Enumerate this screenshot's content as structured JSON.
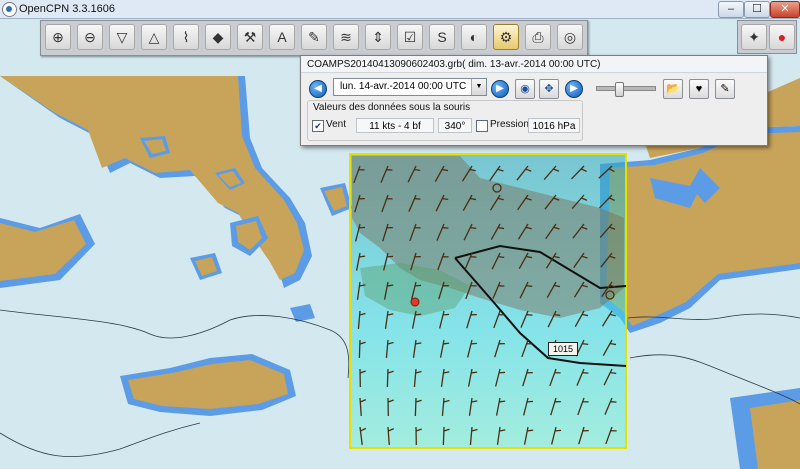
{
  "window": {
    "title": "OpenCPN 3.3.1606",
    "minimize_label": "–",
    "maximize_label": "☐",
    "close_label": "✕"
  },
  "toolbar": {
    "items": [
      {
        "name": "zoom-in",
        "glyph": "⊕"
      },
      {
        "name": "zoom-out",
        "glyph": "⊖"
      },
      {
        "name": "scale-down",
        "glyph": "▽"
      },
      {
        "name": "scale-up",
        "glyph": "△"
      },
      {
        "name": "route",
        "glyph": "⌇"
      },
      {
        "name": "mark",
        "glyph": "◆"
      },
      {
        "name": "settings",
        "glyph": "⚒"
      },
      {
        "name": "text",
        "glyph": "A"
      },
      {
        "name": "measure",
        "glyph": "✎"
      },
      {
        "name": "current",
        "glyph": "≋"
      },
      {
        "name": "tide",
        "glyph": "⇕"
      },
      {
        "name": "route-manager",
        "glyph": "☑"
      },
      {
        "name": "track",
        "glyph": "S"
      },
      {
        "name": "color-scheme",
        "glyph": "◐"
      },
      {
        "name": "grib",
        "glyph": "⚙"
      },
      {
        "name": "print",
        "glyph": "⎙"
      },
      {
        "name": "help",
        "glyph": "◎"
      }
    ],
    "right_items": [
      {
        "name": "compass",
        "glyph": "✦"
      },
      {
        "name": "gps-status",
        "glyph": "●"
      }
    ]
  },
  "grib": {
    "title": "COAMPS20140413090602403.grb( dim. 13-avr.-2014 00:00  UTC)",
    "date_value": "lun. 14-avr.-2014 00:00  UTC",
    "values_caption": "Valeurs des données sous la souris",
    "wind_label": "Vent",
    "wind_checked": true,
    "wind_speed": "11 kts -  4 bf",
    "wind_dir": "340°",
    "pressure_label": "Pression",
    "pressure_checked": false,
    "pressure_value": "1016 hPa",
    "slider_level": 0.35
  },
  "map": {
    "isobar_label": "1015",
    "colors": {
      "sea": "#d4e8ef",
      "land": "#c8a35a",
      "shallow": "#5c9be6",
      "grib_frame": "#e4e000",
      "arrow": "#4a2e12"
    }
  }
}
